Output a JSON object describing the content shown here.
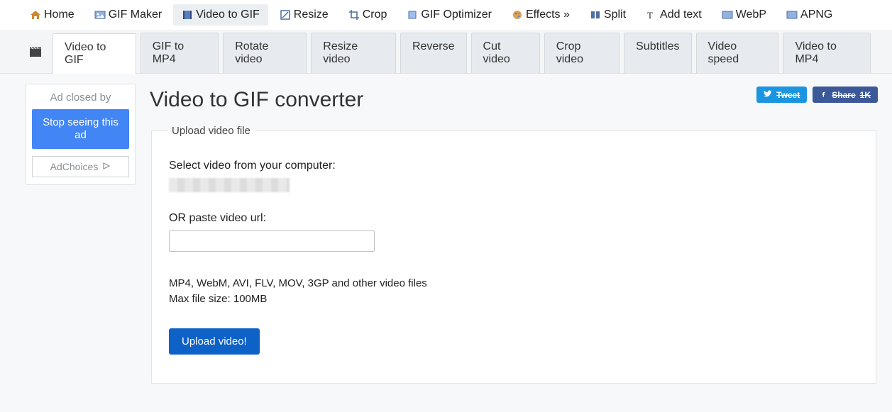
{
  "topnav": {
    "items": [
      {
        "label": "Home",
        "icon": "home"
      },
      {
        "label": "GIF Maker",
        "icon": "gif"
      },
      {
        "label": "Video to GIF",
        "icon": "video",
        "active": true
      },
      {
        "label": "Resize",
        "icon": "resize"
      },
      {
        "label": "Crop",
        "icon": "crop"
      },
      {
        "label": "GIF Optimizer",
        "icon": "opt"
      },
      {
        "label": "Effects »",
        "icon": "fx"
      },
      {
        "label": "Split",
        "icon": "split"
      },
      {
        "label": "Add text",
        "icon": "text"
      },
      {
        "label": "WebP",
        "icon": "webp"
      },
      {
        "label": "APNG",
        "icon": "apng"
      }
    ]
  },
  "subnav": {
    "icon": "clapper",
    "tabs": [
      {
        "label": "Video to GIF",
        "active": true
      },
      {
        "label": "GIF to MP4"
      },
      {
        "label": "Rotate video"
      },
      {
        "label": "Resize video"
      },
      {
        "label": "Reverse"
      },
      {
        "label": "Cut video"
      },
      {
        "label": "Crop video"
      },
      {
        "label": "Subtitles"
      },
      {
        "label": "Video speed"
      },
      {
        "label": "Video to MP4"
      }
    ]
  },
  "sidebar": {
    "closed_label": "Ad closed by",
    "stop_label": "Stop seeing this ad",
    "choices_label": "AdChoices"
  },
  "page": {
    "title": "Video to GIF converter"
  },
  "social": {
    "tweet": "Tweet",
    "share": "Share",
    "share_count": "1K"
  },
  "form": {
    "legend": "Upload video file",
    "select_label": "Select video from your computer:",
    "url_label": "OR paste video url:",
    "url_value": "",
    "hint_line1": "MP4, WebM, AVI, FLV, MOV, 3GP and other video files",
    "hint_line2": "Max file size: 100MB",
    "submit_label": "Upload video!"
  }
}
